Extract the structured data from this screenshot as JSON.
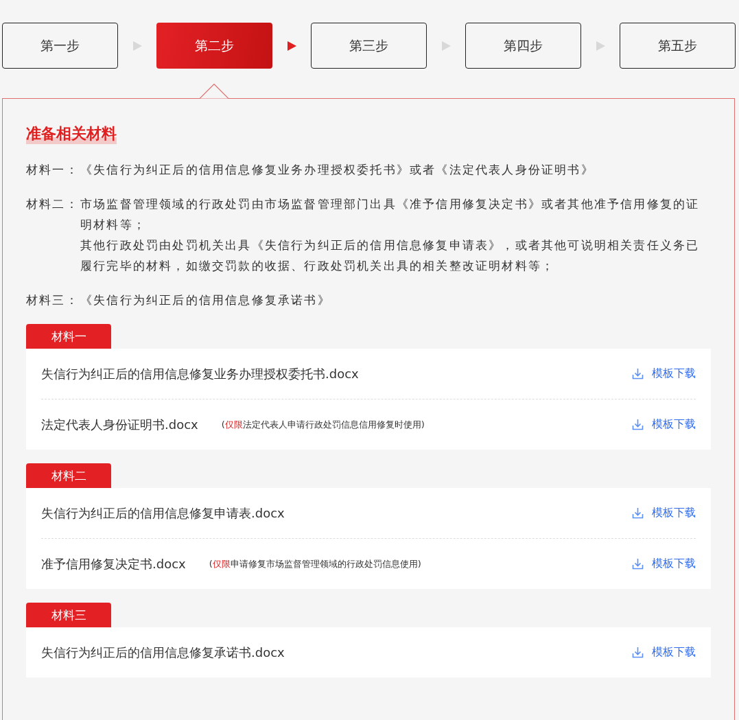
{
  "steps": [
    {
      "label": "第一步",
      "selected": false
    },
    {
      "label": "第二步",
      "selected": true
    },
    {
      "label": "第三步",
      "selected": false
    },
    {
      "label": "第四步",
      "selected": false
    },
    {
      "label": "第五步",
      "selected": false
    }
  ],
  "panel": {
    "title": "准备相关材料",
    "requirements": [
      {
        "label": "材料一：",
        "paragraphs": [
          "《失信行为纠正后的信用信息修复业务办理授权委托书》或者《法定代表人身份证明书》"
        ]
      },
      {
        "label": "材料二：",
        "paragraphs": [
          "市场监督管理领域的行政处罚由市场监督管理部门出具《准予信用修复决定书》或者其他准予信用修复的证明材料等；",
          "其他行政处罚由处罚机关出具《失信行为纠正后的信用信息修复申请表》，或者其他可说明相关责任义务已履行完毕的材料，如缴交罚款的收据、行政处罚机关出具的相关整改证明材料等；"
        ]
      },
      {
        "label": "材料三：",
        "paragraphs": [
          "《失信行为纠正后的信用信息修复承诺书》"
        ]
      }
    ],
    "groups": [
      {
        "tag": "材料一",
        "files": [
          {
            "name": "失信行为纠正后的信用信息修复业务办理授权委托书.docx",
            "link": "模板下载"
          },
          {
            "name": "法定代表人身份证明书.docx",
            "note": {
              "open": "(",
              "highlight": "仅限",
              "text": "法定代表人申请行政处罚信息信用修复时使用)"
            },
            "link": "模板下载"
          }
        ]
      },
      {
        "tag": "材料二",
        "files": [
          {
            "name": "失信行为纠正后的信用信息修复申请表.docx",
            "link": "模板下载"
          },
          {
            "name": "准予信用修复决定书.docx",
            "note": {
              "open": "(",
              "highlight": "仅限",
              "text": "申请修复市场监督管理领域的行政处罚信息使用)"
            },
            "link": "模板下载"
          }
        ]
      },
      {
        "tag": "材料三",
        "files": [
          {
            "name": "失信行为纠正后的信用信息修复承诺书.docx",
            "link": "模板下载"
          }
        ]
      }
    ]
  }
}
